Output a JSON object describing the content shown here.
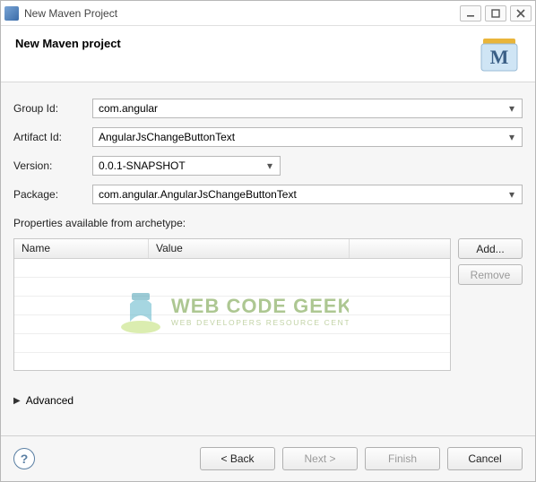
{
  "window": {
    "title": "New Maven Project"
  },
  "header": {
    "title": "New Maven project"
  },
  "form": {
    "groupId": {
      "label": "Group Id:",
      "value": "com.angular"
    },
    "artifactId": {
      "label": "Artifact Id:",
      "value": "AngularJsChangeButtonText"
    },
    "version": {
      "label": "Version:",
      "value": "0.0.1-SNAPSHOT"
    },
    "package": {
      "label": "Package:",
      "value": "com.angular.AngularJsChangeButtonText"
    }
  },
  "properties": {
    "label": "Properties available from archetype:",
    "columns": {
      "name": "Name",
      "value": "Value"
    },
    "buttons": {
      "add": "Add...",
      "remove": "Remove"
    }
  },
  "advanced": {
    "label": "Advanced"
  },
  "footer": {
    "back": "< Back",
    "next": "Next >",
    "finish": "Finish",
    "cancel": "Cancel"
  },
  "watermark": {
    "line1": "WEB CODE GEEKS",
    "line2": "WEB DEVELOPERS RESOURCE CENTER"
  }
}
